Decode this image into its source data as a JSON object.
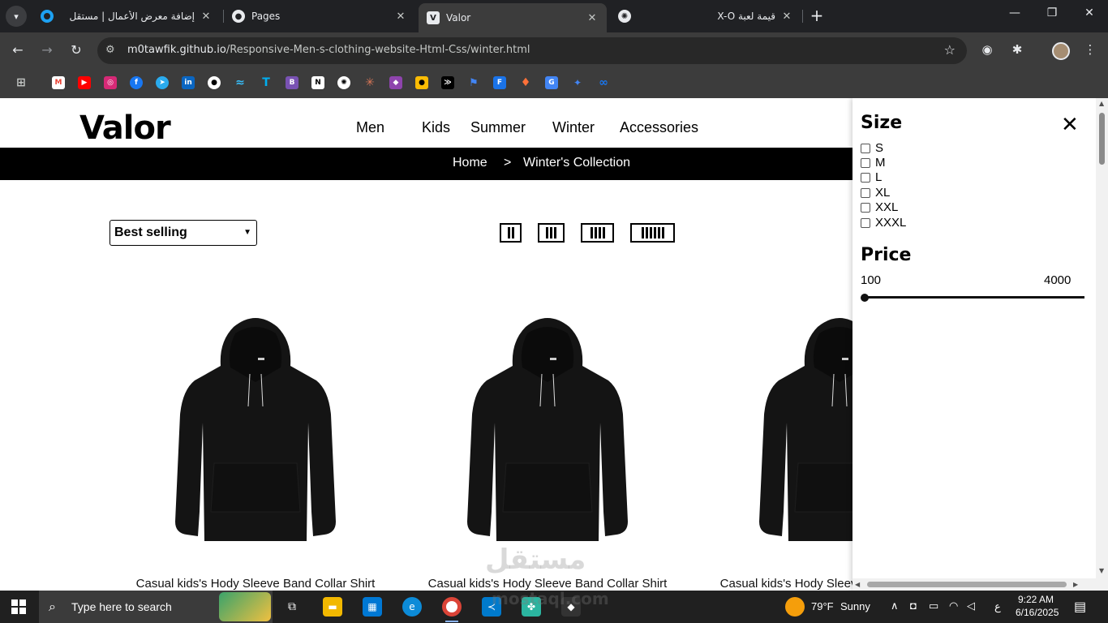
{
  "browser": {
    "tabs": [
      {
        "title": "إضافة معرض الأعمال | مستقل",
        "active": false
      },
      {
        "title": "Pages",
        "active": false
      },
      {
        "title": "Valor",
        "active": true
      },
      {
        "title": "قيمة لعبة X-O",
        "active": false
      }
    ],
    "url_host": "m0tawfik.github.io",
    "url_path": "/Responsive-Men-s-clothing-website-Html-Css/winter.html"
  },
  "site": {
    "logo": "Valor",
    "nav": [
      "Men",
      "Kids",
      "Summer",
      "Winter",
      "Accessories"
    ],
    "breadcrumb": {
      "home": "Home",
      "separator": ">",
      "current": "Winter's Collection"
    },
    "sort": {
      "selected": "Best selling"
    },
    "products": [
      {
        "title": "Casual kids's Hody Sleeve Band Collar Shirt"
      },
      {
        "title": "Casual kids's Hody Sleeve Band Collar Shirt"
      },
      {
        "title": "Casual kids's Hody Sleeve Band Collar Shirt"
      }
    ]
  },
  "filter": {
    "size_title": "Size",
    "sizes": [
      "S",
      "M",
      "L",
      "XL",
      "XXL",
      "XXXL"
    ],
    "price_title": "Price",
    "price_min": "100",
    "price_max": "4000",
    "close_icon": "close-icon"
  },
  "watermark": {
    "line1": "مستقل",
    "line2": "mostaql.com"
  },
  "taskbar": {
    "search_placeholder": "Type here to search",
    "weather_temp": "79°F",
    "weather_desc": "Sunny",
    "lang": "ع",
    "time": "9:22 AM",
    "date": "6/16/2025"
  },
  "colors": {
    "chrome_dark": "#202124",
    "chrome_bar": "#3c3c3c",
    "page_bg": "#ffffff",
    "breadcrumb_bg": "#000000"
  }
}
